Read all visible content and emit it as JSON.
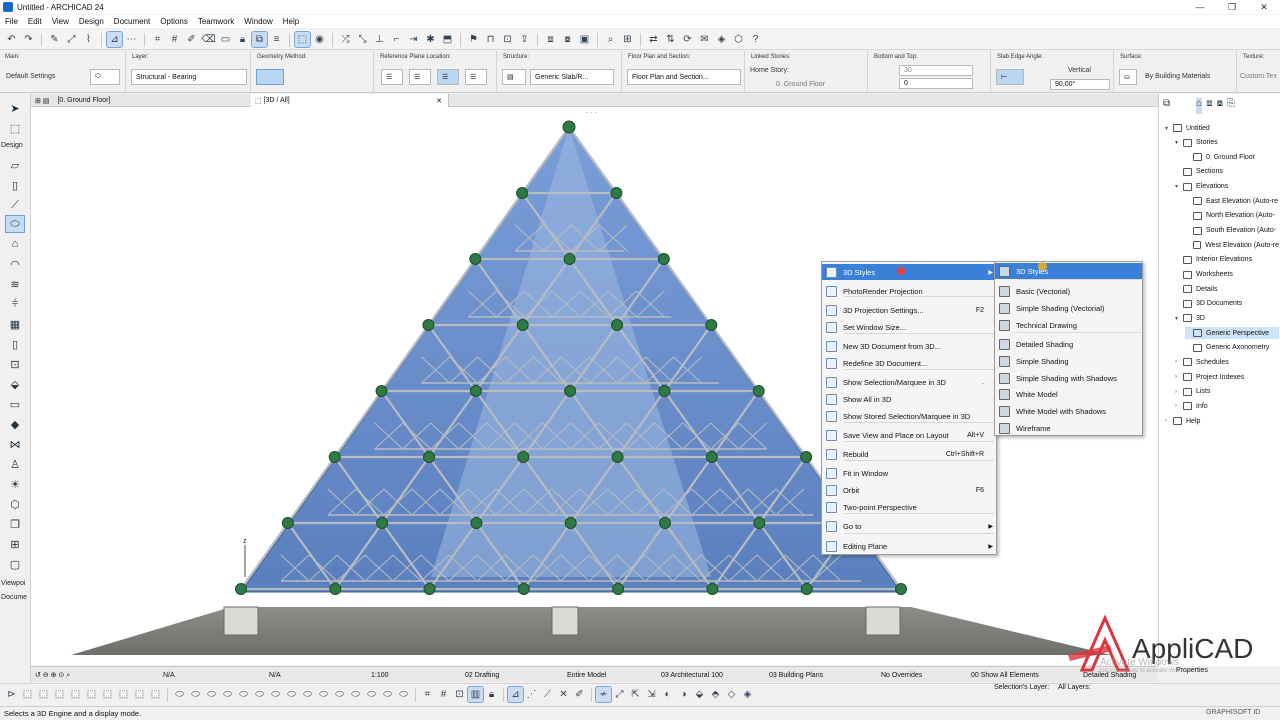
{
  "window": {
    "title": "Untitled - ARCHICAD 24"
  },
  "menu": [
    "File",
    "Edit",
    "View",
    "Design",
    "Document",
    "Options",
    "Teamwork",
    "Window",
    "Help"
  ],
  "infobox": {
    "main_label": "Main:",
    "main_value": "Default Settings",
    "layer_label": "Layer:",
    "layer_value": "Structural - Bearing",
    "geometry_label": "Geometry Method:",
    "refplane_label": "Reference Plane Location:",
    "structure_label": "Structure:",
    "structure_value": "Generic Slab/R...",
    "floorplan_label": "Floor Plan and Section:",
    "floorplan_value": "Floor Plan and Section...",
    "linked_label": "Linked Stories:",
    "home_story_label": "Home Story:",
    "home_story_value": "0. Ground Floor",
    "bottomtop_label": "Bottom and Top:",
    "top_value": "30",
    "bottom_value": "0",
    "slabedge_label": "Slab Edge Angle:",
    "vertical_label": "Vertical",
    "angle_value": "90,00°",
    "surface_label": "Surface:",
    "surface_value": "By Building Materials",
    "texture_label": "Texture:",
    "texture_value": "Custom Tex"
  },
  "toolbox": {
    "design_label": "Design",
    "viewpoint_label": "Viewpoi",
    "document_label": "Docume"
  },
  "tabs": {
    "floor": "[0. Ground Floor]",
    "view3d": "[3D / All]"
  },
  "navigator": {
    "items": [
      {
        "label": "Untitled",
        "level": 0,
        "tw": "▾"
      },
      {
        "label": "Stories",
        "level": 1,
        "tw": "▾"
      },
      {
        "label": "0. Ground Floor",
        "level": 2,
        "tw": ""
      },
      {
        "label": "Sections",
        "level": 1,
        "tw": ""
      },
      {
        "label": "Elevations",
        "level": 1,
        "tw": "▾"
      },
      {
        "label": "East Elevation (Auto-re",
        "level": 2,
        "tw": ""
      },
      {
        "label": "North Elevation (Auto-",
        "level": 2,
        "tw": ""
      },
      {
        "label": "South Elevation (Auto-",
        "level": 2,
        "tw": ""
      },
      {
        "label": "West Elevation (Auto-re",
        "level": 2,
        "tw": ""
      },
      {
        "label": "Interior Elevations",
        "level": 1,
        "tw": ""
      },
      {
        "label": "Worksheets",
        "level": 1,
        "tw": ""
      },
      {
        "label": "Details",
        "level": 1,
        "tw": ""
      },
      {
        "label": "3D Documents",
        "level": 1,
        "tw": ""
      },
      {
        "label": "3D",
        "level": 1,
        "tw": "▾"
      },
      {
        "label": "Generic Perspective",
        "level": 2,
        "tw": "",
        "selected": true
      },
      {
        "label": "Generic Axonometry",
        "level": 2,
        "tw": ""
      },
      {
        "label": "Schedules",
        "level": 1,
        "tw": "›"
      },
      {
        "label": "Project Indexes",
        "level": 1,
        "tw": "›"
      },
      {
        "label": "Lists",
        "level": 1,
        "tw": "›"
      },
      {
        "label": "Info",
        "level": 1,
        "tw": "›"
      },
      {
        "label": "Help",
        "level": 0,
        "tw": "›"
      }
    ]
  },
  "context_menu": {
    "items": [
      {
        "label": "3D Styles",
        "shortcut": "",
        "submenu": true,
        "highlight": true
      },
      {
        "label": "PhotoRender Projection",
        "shortcut": ""
      },
      {
        "label": "3D Projection Settings...",
        "shortcut": "F2"
      },
      {
        "label": "Set Window Size...",
        "shortcut": ""
      },
      {
        "label": "New 3D Document from 3D...",
        "shortcut": ""
      },
      {
        "label": "Redefine 3D Document...",
        "shortcut": ""
      },
      {
        "label": "Show Selection/Marquee in 3D",
        "shortcut": "."
      },
      {
        "label": "Show All in 3D",
        "shortcut": ""
      },
      {
        "label": "Show Stored Selection/Marquee in 3D",
        "shortcut": ""
      },
      {
        "label": "Save View and Place on Layout",
        "shortcut": "Alt+V"
      },
      {
        "label": "Rebuild",
        "shortcut": "Ctrl+Shift+R"
      },
      {
        "label": "Fit in Window",
        "shortcut": ""
      },
      {
        "label": "Orbit",
        "shortcut": "F6"
      },
      {
        "label": "Two-point Perspective",
        "shortcut": ""
      },
      {
        "label": "Go to",
        "shortcut": "",
        "submenu": true
      },
      {
        "label": "Editing Plane",
        "shortcut": "",
        "submenu": true
      }
    ]
  },
  "styles_submenu": {
    "items": [
      "3D Styles",
      "Basic (Vectorial)",
      "Simple Shading (Vectorial)",
      "Technical Drawing",
      "Detailed Shading",
      "Simple Shading",
      "Simple Shading with Shadows",
      "White Model",
      "White Model with Shadows",
      "Wireframe"
    ]
  },
  "quick_options": {
    "na1": "N/A",
    "na2": "N/A",
    "scale": "1:100",
    "pen": "02 Drafting",
    "model": "Entire Model",
    "mvo": "03 Architectural 100",
    "layer_combo": "03 Building Plans",
    "override": "No Overrides",
    "renovation": "00 Show All Elements",
    "shading": "Detailed Shading"
  },
  "bottom": {
    "properties": "Properties",
    "selections_layer": "Selection's Layer:",
    "all_layers": "All Layers:"
  },
  "status": {
    "text": "Selects a 3D Engine and a display mode.",
    "vendor": "GRAPHISOFT ID"
  },
  "brand": {
    "name": "AppliCAD",
    "activate1": "Activate Windows",
    "activate2": "Go to Settings to activate Windows."
  },
  "colors": {
    "accent": "#3a80d8",
    "glass": "#5f86c8",
    "node": "#2f7a44",
    "ground": "#7c7c78",
    "brand_red": "#d9363e"
  }
}
